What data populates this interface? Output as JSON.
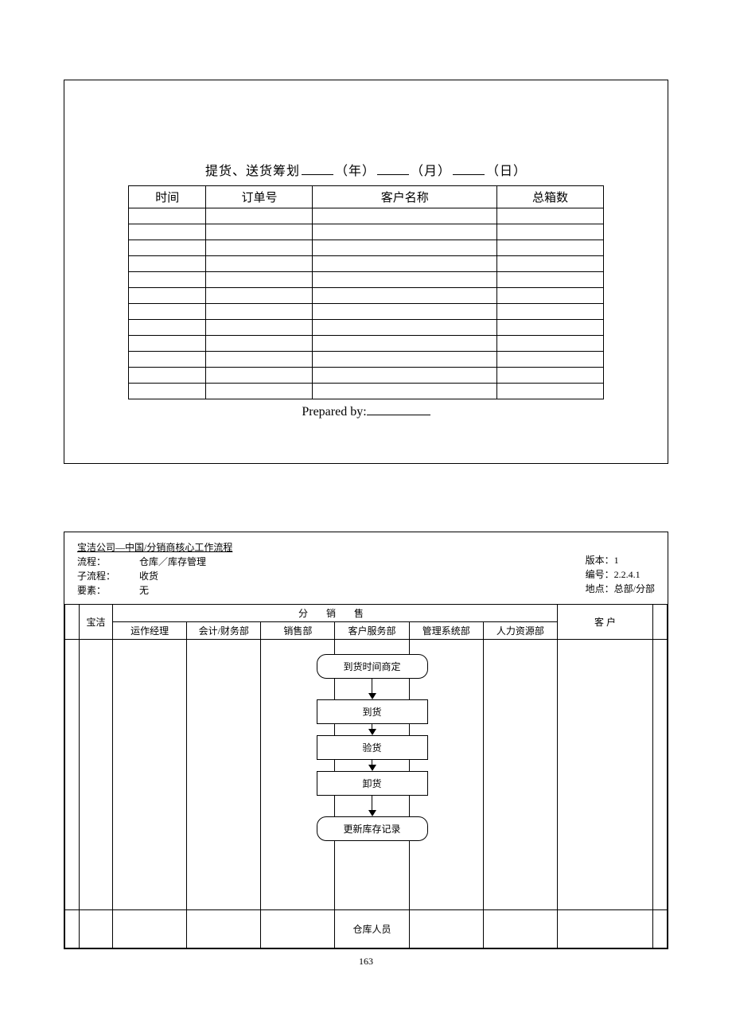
{
  "plan": {
    "title_prefix": "提货、送货筹划",
    "year_label": "（年）",
    "month_label": "（月）",
    "day_label": "（日）",
    "headers": [
      "时间",
      "订单号",
      "客户名称",
      "总箱数"
    ],
    "row_count": 12,
    "prepared_label": "Prepared by:"
  },
  "workflow": {
    "company_title": "宝洁公司—中国/分销商核心工作流程",
    "process_label": "流程：",
    "process_value": "仓库／库存管理",
    "subprocess_label": "子流程：",
    "subprocess_value": "收货",
    "element_label": "要素：",
    "element_value": "无",
    "version_label": "版本：",
    "version_value": "1",
    "number_label": "编号：",
    "number_value": "2.2.4.1",
    "location_label": "地点：",
    "location_value": "总部/分部",
    "swim": {
      "baojie": "宝洁",
      "distributor_header": "分  销  售",
      "ops": "运作经理",
      "accounting": "会计/财务部",
      "sales": "销售部",
      "cs": "客户服务部",
      "mis": "管理系统部",
      "hr": "人力资源部",
      "customer": "客      户"
    },
    "flow_steps": {
      "s1": "到货时间商定",
      "s2": "到货",
      "s3": "验货",
      "s4": "卸货",
      "s5": "更新库存记录"
    },
    "footer_role": "仓库人员"
  },
  "page_number": "163"
}
